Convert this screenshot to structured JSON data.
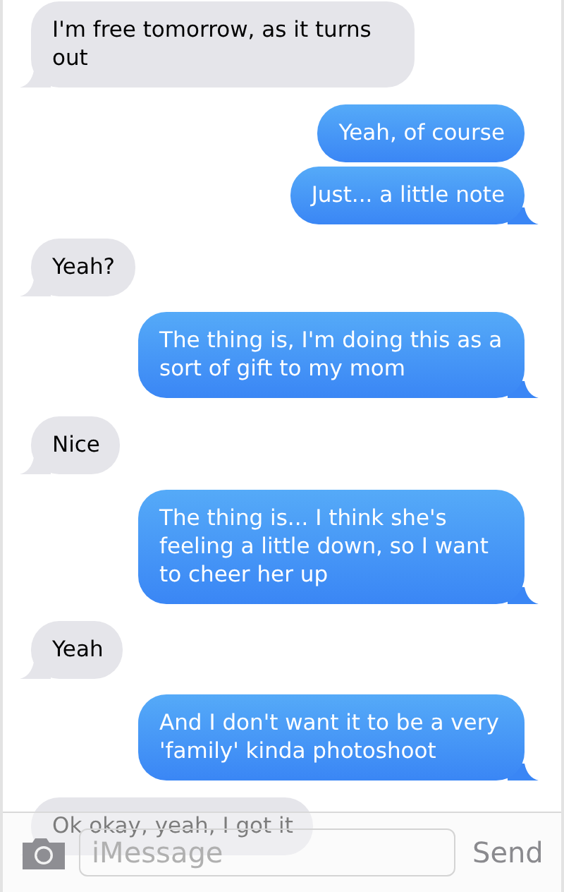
{
  "messages": [
    {
      "kind": "incoming",
      "text": "I'm free tomorrow, as it turns out"
    },
    {
      "kind": "outgoing",
      "text": "Yeah, of course",
      "tail": false
    },
    {
      "kind": "outgoing",
      "text": "Just... a little note",
      "tail": true
    },
    {
      "kind": "incoming",
      "text": "Yeah?"
    },
    {
      "kind": "outgoing",
      "text": "The thing is, I'm doing this as a sort of gift to my mom",
      "tail": true
    },
    {
      "kind": "incoming",
      "text": "Nice"
    },
    {
      "kind": "outgoing",
      "text": "The thing is... I think she's feeling a little down, so I want to cheer her up",
      "tail": true
    },
    {
      "kind": "incoming",
      "text": "Yeah"
    },
    {
      "kind": "outgoing",
      "text": "And I don't want it to be a very 'family' kinda photoshoot",
      "tail": true
    },
    {
      "kind": "incoming",
      "text": "Ok okay, yeah, I got it"
    }
  ],
  "composer": {
    "placeholder": "iMessage",
    "send_label": "Send"
  }
}
